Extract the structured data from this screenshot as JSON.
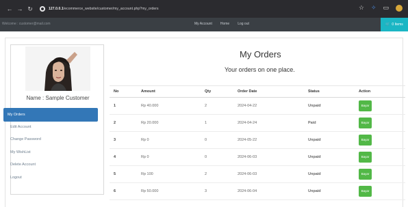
{
  "browser": {
    "url_host": "127.0.0.1",
    "url_path": "/ecommerce_website/customer/my_account.php?my_orders"
  },
  "navbar": {
    "welcome_text": "Welcome : customer@mail.com",
    "links": [
      "My Account",
      "Home",
      "Log out"
    ],
    "cart_label": "0 Items"
  },
  "sidebar": {
    "customer_name": "Name : Sample Customer",
    "menu": [
      "My Orders",
      "Edit Account",
      "Change Password",
      "My WishList",
      "Delete Account",
      "Logout"
    ],
    "active_index": 0
  },
  "main": {
    "title": "My Orders",
    "subtitle": "Your orders on one place."
  },
  "table": {
    "headers": [
      "No",
      "Amount",
      "Qty",
      "Order Date",
      "Status",
      "Action"
    ],
    "rows": [
      {
        "no": "1",
        "amount": "Rp 40.000",
        "qty": "2",
        "date": "2024-04-22",
        "status": "Unpaid",
        "action": "Bayar"
      },
      {
        "no": "2",
        "amount": "Rp 20.000",
        "qty": "1",
        "date": "2024-04-24",
        "status": "Paid",
        "action": "Bayar"
      },
      {
        "no": "3",
        "amount": "Rp 0",
        "qty": "0",
        "date": "2024-05-22",
        "status": "Unpaid",
        "action": "Bayar"
      },
      {
        "no": "4",
        "amount": "Rp 0",
        "qty": "0",
        "date": "2024-06-03",
        "status": "Unpaid",
        "action": "Bayar"
      },
      {
        "no": "5",
        "amount": "Rp 100",
        "qty": "2",
        "date": "2024-06-03",
        "status": "Unpaid",
        "action": "Bayar"
      },
      {
        "no": "6",
        "amount": "Rp 50.000",
        "qty": "3",
        "date": "2024-06-04",
        "status": "Unpaid",
        "action": "Bayar"
      }
    ]
  },
  "colors": {
    "navbar_bg": "#3a3f44",
    "cart_bg": "#1bb6c4",
    "active_menu_bg": "#3377b7",
    "pay_button": "#52b847",
    "unpaid": "#c9302c",
    "paid": "#3a8a32"
  },
  "icons": [
    "back-icon",
    "forward-icon",
    "reload-icon",
    "site-info-icon",
    "bookmark-star-icon",
    "extension-icon",
    "puzzle-icon",
    "profile-icon",
    "cart-icon"
  ]
}
